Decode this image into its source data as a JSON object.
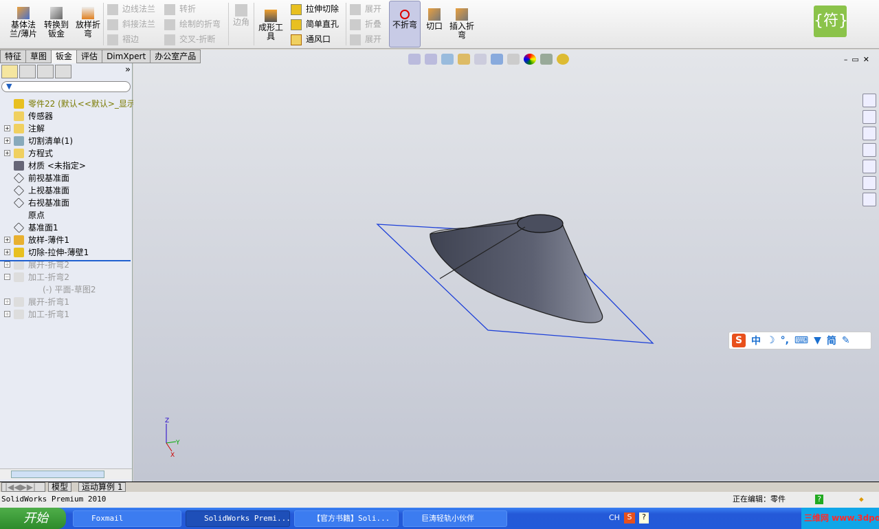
{
  "toolbar": {
    "big": [
      "基体法兰/薄片",
      "转换到钣金",
      "放样折弯"
    ],
    "col1": [
      "边线法兰",
      "斜接法兰",
      "褶边"
    ],
    "col2": [
      "转折",
      "绘制的折弯",
      "交叉-折断"
    ],
    "corner": "边角",
    "forming": "成形工具",
    "col3": [
      "拉伸切除",
      "简单直孔",
      "通风口"
    ],
    "col4": [
      "展开",
      "折叠",
      "展开"
    ],
    "nofold": "不折弯",
    "cut": "切口",
    "insert": "插入折弯",
    "logo": "{符}"
  },
  "tabs": [
    "特征",
    "草图",
    "钣金",
    "评估",
    "DimXpert",
    "办公室产品"
  ],
  "tree": [
    {
      "label": "零件22    (默认<<默认>_显示",
      "icon": "part-icon",
      "pm": false,
      "gray": false
    },
    {
      "label": "传感器",
      "icon": "sensor-icon",
      "pm": false
    },
    {
      "label": "注解",
      "icon": "annotation-icon",
      "pm": true
    },
    {
      "label": "切割清单(1)",
      "icon": "cut-list-icon",
      "pm": true
    },
    {
      "label": "方程式",
      "icon": "equation-icon",
      "pm": true
    },
    {
      "label": "材质 <未指定>",
      "icon": "material-icon",
      "pm": false
    },
    {
      "label": "前视基准面",
      "icon": "plane-icon",
      "pm": false
    },
    {
      "label": "上视基准面",
      "icon": "plane-icon",
      "pm": false
    },
    {
      "label": "右视基准面",
      "icon": "plane-icon",
      "pm": false
    },
    {
      "label": "原点",
      "icon": "origin-icon",
      "pm": false
    },
    {
      "label": "基准面1",
      "icon": "plane-icon",
      "pm": false
    },
    {
      "label": "放样-薄件1",
      "icon": "loft-icon",
      "pm": true
    },
    {
      "label": "切除-拉伸-薄壁1",
      "icon": "cut-extrude-icon",
      "pm": true
    },
    {
      "label": "展开-折弯2",
      "icon": "unfold-icon",
      "pm": true,
      "gray": true
    },
    {
      "label": "加工-折弯2",
      "icon": "process-bend-icon",
      "pm": true,
      "gray": true
    },
    {
      "label": "(-) 平面-草图2",
      "icon": "sketch-icon",
      "pm": false,
      "gray": true
    },
    {
      "label": "展开-折弯1",
      "icon": "unfold-icon",
      "pm": true,
      "gray": true
    },
    {
      "label": "加工-折弯1",
      "icon": "process-bend-icon",
      "pm": true,
      "gray": true
    }
  ],
  "ime": [
    "中",
    "简"
  ],
  "bottom_tabs": [
    "模型",
    "运动算例 1"
  ],
  "status": {
    "app": "SolidWorks Premium 2010",
    "editing": "正在编辑：零件"
  },
  "taskbar": {
    "start": "开始",
    "tasks": [
      "Foxmail",
      "SolidWorks Premi...",
      "【官方书籍】Soli...",
      "巨涛轻轨小伙伴"
    ],
    "lang": "CH",
    "watermark": "三维网 www.3dportal.cn"
  },
  "triad": {
    "x": "X",
    "y": "Y",
    "z": "Z"
  },
  "colors": {
    "accent": "#1c3fd8",
    "model": "#555a6a"
  }
}
